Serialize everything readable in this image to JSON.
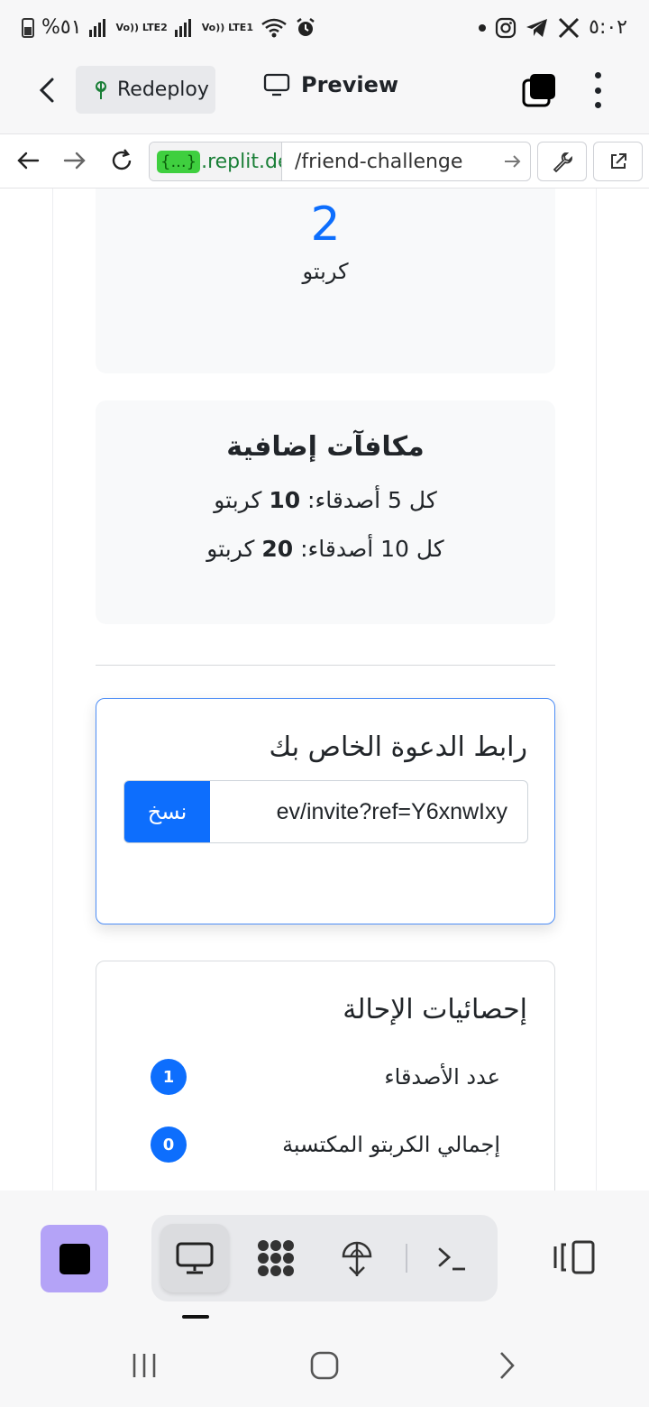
{
  "status_bar": {
    "time": "٥:٠٢",
    "battery": "%٥١",
    "sim1": "Vo)) LTE2",
    "sim2": "Vo)) LTE1"
  },
  "toolbar": {
    "redeploy_label": "Redeploy",
    "preview_label": "Preview"
  },
  "url_bar": {
    "badge": "{...}",
    "host": ".replit.de",
    "path": "/friend-challenge"
  },
  "reward_card": {
    "value": "2",
    "unit": "كربتو"
  },
  "bonus_card": {
    "title": "مكافآت إضافية",
    "line1_prefix": "كل 5 أصدقاء: ",
    "line1_value": "10",
    "line1_suffix": " كربتو",
    "line2_prefix": "كل 10 أصدقاء: ",
    "line2_value": "20",
    "line2_suffix": " كربتو"
  },
  "invite_card": {
    "title": "رابط الدعوة الخاص بك",
    "link_value": "ev/invite?ref=Y6xnwIxy",
    "copy_label": "نسخ"
  },
  "stats_card": {
    "title": "إحصائيات الإحالة",
    "rows": [
      {
        "label": "عدد الأصدقاء",
        "value": "1"
      },
      {
        "label": "إجمالي الكربتو المكتسبة",
        "value": "0"
      }
    ]
  },
  "colors": {
    "primary": "#0d6efd",
    "stop_button": "#b4a3f7",
    "url_badge": "#3fcf3f"
  }
}
